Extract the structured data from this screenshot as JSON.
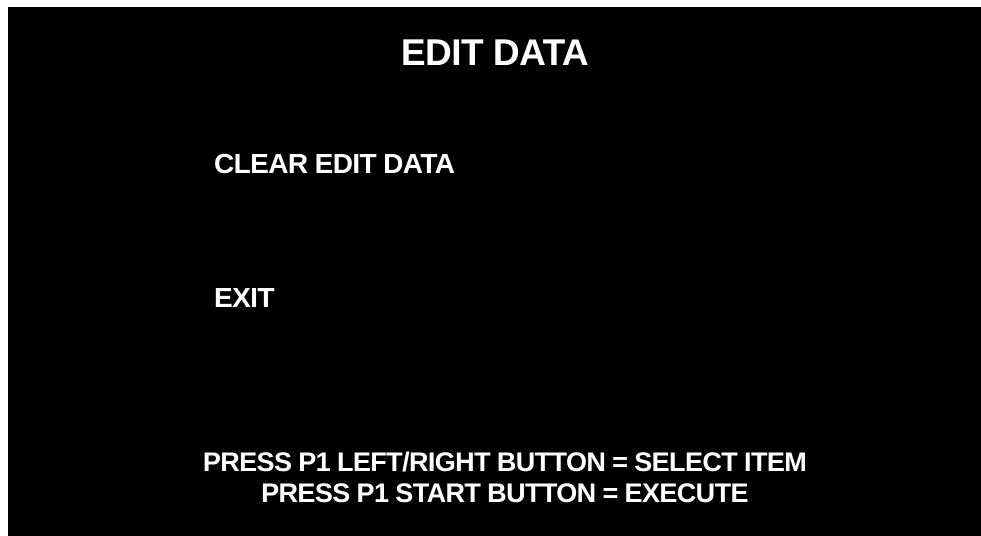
{
  "screen": {
    "title": "EDIT DATA",
    "background_color": "#000000",
    "text_color": "#ffffff"
  },
  "menu": {
    "items": [
      {
        "label": "CLEAR EDIT DATA"
      },
      {
        "label": "EXIT"
      }
    ]
  },
  "instructions": {
    "line1": "PRESS P1 LEFT/RIGHT BUTTON = SELECT ITEM",
    "line2": "PRESS P1 START BUTTON = EXECUTE"
  }
}
